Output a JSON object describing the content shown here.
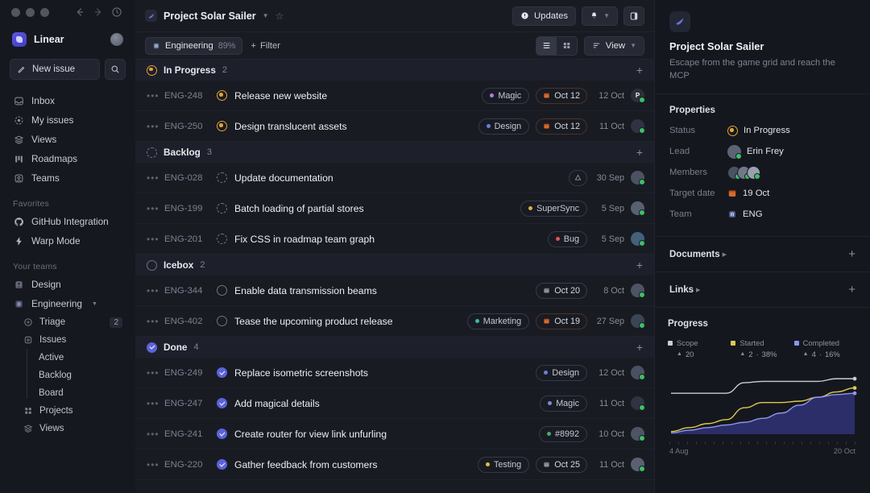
{
  "window": {
    "nav_back": "back-arrow",
    "nav_forward": "forward-arrow",
    "history": "history-clock"
  },
  "sidebar": {
    "brand": "Linear",
    "new_issue_label": "New issue",
    "search_placeholder": "Search",
    "nav": [
      {
        "label": "Inbox",
        "icon": "inbox-icon"
      },
      {
        "label": "My issues",
        "icon": "my-issues-icon"
      },
      {
        "label": "Views",
        "icon": "views-icon"
      },
      {
        "label": "Roadmaps",
        "icon": "roadmaps-icon"
      },
      {
        "label": "Teams",
        "icon": "teams-icon"
      }
    ],
    "favorites_title": "Favorites",
    "favorites": [
      {
        "label": "GitHub Integration",
        "icon": "github-icon"
      },
      {
        "label": "Warp Mode",
        "icon": "bolt-icon"
      }
    ],
    "teams_title": "Your teams",
    "teams": [
      {
        "label": "Design",
        "icon": "design-team-icon",
        "expanded": false
      },
      {
        "label": "Engineering",
        "icon": "engineering-team-icon",
        "expanded": true
      }
    ],
    "engineering_children": [
      {
        "label": "Triage",
        "icon": "triage-icon",
        "count": "2"
      },
      {
        "label": "Issues",
        "icon": "issues-icon",
        "count": ""
      }
    ],
    "issues_leaves": [
      "Active",
      "Backlog",
      "Board"
    ],
    "engineering_tail": [
      {
        "label": "Projects",
        "icon": "projects-icon"
      },
      {
        "label": "Views",
        "icon": "views-icon"
      }
    ]
  },
  "topbar": {
    "project_title": "Project Solar Sailer",
    "updates_label": "Updates",
    "notifications_icon": "bell-icon",
    "panel_icon": "side-panel-icon",
    "star_icon": "star-icon"
  },
  "filterbar": {
    "team_pill": "Engineering",
    "team_pct": "89%",
    "filter_label": "Filter",
    "view_label": "View",
    "list_view_icon": "list-view-icon",
    "board_view_icon": "board-view-icon"
  },
  "groups": [
    {
      "name": "In Progress",
      "count": "2",
      "status": "prog",
      "rows": [
        {
          "id": "ENG-248",
          "title": "Release new website",
          "status": "prog",
          "label": {
            "text": "Magic",
            "color": "#b07ce8"
          },
          "date": {
            "text": "Oct 12",
            "tone": "warn"
          },
          "ts": "12 Oct",
          "avatar": {
            "initial": "P",
            "color": "#2b2f3c"
          }
        },
        {
          "id": "ENG-250",
          "title": "Design translucent assets",
          "status": "prog",
          "label": {
            "text": "Design",
            "color": "#6f7dd6"
          },
          "date": {
            "text": "Oct 12",
            "tone": "warn"
          },
          "ts": "11 Oct",
          "avatar": {
            "initial": "",
            "color": "#2f3342"
          }
        }
      ]
    },
    {
      "name": "Backlog",
      "count": "3",
      "status": "back",
      "rows": [
        {
          "id": "ENG-028",
          "title": "Update documentation",
          "status": "back",
          "label": null,
          "date": null,
          "priority_icon": "priority-icon",
          "ts": "30 Sep",
          "avatar": {
            "initial": "",
            "color": "#4c5261"
          }
        },
        {
          "id": "ENG-199",
          "title": "Batch loading of partial stores",
          "status": "back",
          "label": {
            "text": "SuperSync",
            "color": "#d6b24a"
          },
          "date": null,
          "ts": "5 Sep",
          "avatar": {
            "initial": "",
            "color": "#596072"
          }
        },
        {
          "id": "ENG-201",
          "title": "Fix CSS in roadmap team graph",
          "status": "back",
          "label": {
            "text": "Bug",
            "color": "#e05252"
          },
          "date": null,
          "ts": "5 Sep",
          "avatar": {
            "initial": "",
            "color": "#44607a"
          }
        }
      ]
    },
    {
      "name": "Icebox",
      "count": "2",
      "status": "ice",
      "rows": [
        {
          "id": "ENG-344",
          "title": "Enable data transmission beams",
          "status": "ice",
          "label": null,
          "date": {
            "text": "Oct 20",
            "tone": "neutral"
          },
          "ts": "8 Oct",
          "avatar": {
            "initial": "",
            "color": "#4e5464"
          }
        },
        {
          "id": "ENG-402",
          "title": "Tease the upcoming product release",
          "status": "ice",
          "label": {
            "text": "Marketing",
            "color": "#3fb9a5"
          },
          "date": {
            "text": "Oct 19",
            "tone": "warn"
          },
          "ts": "27 Sep",
          "avatar": {
            "initial": "",
            "color": "#3c4556"
          }
        }
      ]
    },
    {
      "name": "Done",
      "count": "4",
      "status": "done",
      "rows": [
        {
          "id": "ENG-249",
          "title": "Replace isometric screenshots",
          "status": "done",
          "label": {
            "text": "Design",
            "color": "#6f7dd6"
          },
          "date": null,
          "ts": "12 Oct",
          "avatar": {
            "initial": "",
            "color": "#4a5163"
          }
        },
        {
          "id": "ENG-247",
          "title": "Add magical details",
          "status": "done",
          "label": {
            "text": "Magic",
            "color": "#7e8ae0"
          },
          "date": null,
          "ts": "11 Oct",
          "avatar": {
            "initial": "",
            "color": "#2f3342"
          }
        },
        {
          "id": "ENG-241",
          "title": "Create router for view link unfurling",
          "status": "done",
          "label": {
            "text": "#8992",
            "color": "#4aa86a"
          },
          "date": null,
          "ts": "10 Oct",
          "avatar": {
            "initial": "",
            "color": "#4e5464"
          }
        },
        {
          "id": "ENG-220",
          "title": "Gather feedback from customers",
          "status": "done",
          "label": {
            "text": "Testing",
            "color": "#d4c14a"
          },
          "date": {
            "text": "Oct 25",
            "tone": "neutral"
          },
          "ts": "11 Oct",
          "avatar": {
            "initial": "",
            "color": "#5a6072"
          }
        }
      ]
    }
  ],
  "right": {
    "title": "Project Solar Sailer",
    "description": "Escape from the game grid and reach the MCP",
    "properties_heading": "Properties",
    "properties": [
      {
        "key": "Status",
        "value": "In Progress",
        "icon": "in-progress-icon"
      },
      {
        "key": "Lead",
        "value": "Erin Frey",
        "icon": "avatar-icon"
      },
      {
        "key": "Members",
        "value": "",
        "icon": "member-avatars"
      },
      {
        "key": "Target date",
        "value": "19 Oct",
        "icon": "calendar-icon"
      },
      {
        "key": "Team",
        "value": "ENG",
        "icon": "team-icon"
      }
    ],
    "documents_heading": "Documents",
    "links_heading": "Links",
    "progress_heading": "Progress"
  },
  "chart_data": {
    "type": "area",
    "title": "Progress",
    "xlabel": "",
    "ylabel": "",
    "x_start": "4 Aug",
    "x_end": "20 Oct",
    "grid": false,
    "legend_position": "top",
    "legend": [
      {
        "name": "Scope",
        "delta": "20",
        "pct": "",
        "color": "#c9ccd6"
      },
      {
        "name": "Started",
        "delta": "2",
        "pct": "38%",
        "color": "#ddc94f"
      },
      {
        "name": "Completed",
        "delta": "4",
        "pct": "16%",
        "color": "#8f95ee"
      }
    ],
    "x": [
      0,
      10,
      20,
      30,
      40,
      50,
      60,
      70,
      80,
      90,
      100
    ],
    "series": [
      {
        "name": "Scope",
        "color": "#c9ccd6",
        "values": [
          62,
          62,
          62,
          62,
          78,
          80,
          80,
          80,
          80,
          84,
          84
        ]
      },
      {
        "name": "Started",
        "color": "#ddc94f",
        "values": [
          4,
          10,
          16,
          22,
          40,
          48,
          48,
          50,
          56,
          64,
          70
        ]
      },
      {
        "name": "Completed",
        "color": "#8f95ee",
        "fill": "#3f41a8",
        "values": [
          2,
          6,
          10,
          14,
          18,
          24,
          32,
          44,
          56,
          60,
          62
        ]
      }
    ]
  }
}
